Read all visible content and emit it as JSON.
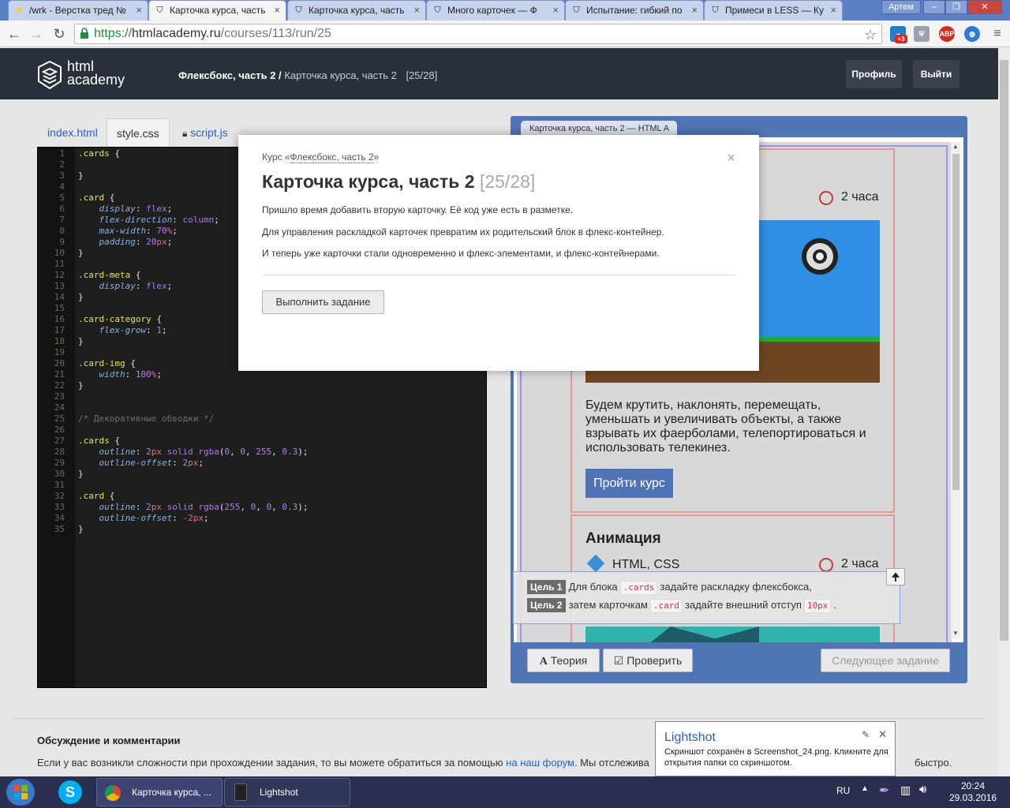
{
  "browser": {
    "tabs": [
      {
        "label": "/wrk - Верстка тред №",
        "icon": "lightning-icon"
      },
      {
        "label": "Карточка курса, часть",
        "icon": "htmlacademy-icon",
        "active": true
      },
      {
        "label": "Карточка курса, часть",
        "icon": "htmlacademy-icon"
      },
      {
        "label": "Много карточек — Ф",
        "icon": "htmlacademy-icon"
      },
      {
        "label": "Испытание: гибкий по",
        "icon": "htmlacademy-icon"
      },
      {
        "label": "Примеси в LESS — Ку",
        "icon": "htmlacademy-icon"
      }
    ],
    "user_label": "Артем",
    "url_proto": "https://",
    "url_host": "htmlacademy.ru",
    "url_path": "/courses/113/run/25",
    "ext_badge": "+3",
    "abp_label": "ABP"
  },
  "site": {
    "logo_line1": "html",
    "logo_line2": "academy",
    "crumb_parent": "Флексбокс, часть 2 /",
    "crumb_current": "Карточка курса, часть 2",
    "crumb_progress": "[25/28]",
    "profile_label": "Профиль",
    "logout_label": "Выйти"
  },
  "files": {
    "tabs": [
      "index.html",
      "style.css",
      "script.js"
    ]
  },
  "preview": {
    "tab_label": "Карточка курса, часть 2 — HTML A",
    "card1_time": "2 часа",
    "card1_text": "Будем крутить, наклонять, перемещать, уменьшать и увеличивать объекты, а также взрывать их фаерболами, телепортироваться и использовать телекинез.",
    "card1_button": "Пройти курс",
    "card2_title": "Анимация",
    "card2_category": "HTML, CSS",
    "card2_time": "2 часа",
    "colors": {
      "accent": "#5075b6",
      "button": "#5073b6",
      "sky": "#2f8fe4",
      "grass": "#17b52b",
      "dirt": "#6e4624",
      "teal": "#2fb3ab"
    }
  },
  "goals": [
    {
      "badge": "Цель 1",
      "pre": "Для блока",
      "code": ".cards",
      "post": "задайте раскладку флексбокса,"
    },
    {
      "badge": "Цель 2",
      "pre": "затем карточкам",
      "code": ".card",
      "post": "задайте внешний отступ",
      "code2": "10px",
      "tail": "."
    }
  ],
  "actions": {
    "theory": "Теория",
    "check": "Проверить",
    "next": "Следующее задание"
  },
  "modal": {
    "course_prefix": "Курс «",
    "course_link": "Флексбокс, часть 2",
    "course_suffix": "»",
    "title": "Карточка курса, часть 2",
    "progress": "[25/28]",
    "paragraphs": [
      "Пришло время добавить вторую карточку. Её код уже есть в разметке.",
      "Для управления раскладкой карточек превратим их родительский блок в флекс-контейнер.",
      "И теперь уже карточки стали одновременно и флекс-элементами, и флекс-контейнерами."
    ],
    "start_button": "Выполнить задание",
    "close_label": "×"
  },
  "comments": {
    "heading": "Обсуждение и комментарии",
    "text_before": "Если у вас возникли сложности при прохождении задания, то вы можете обратиться за помощью",
    "link": "на наш форум",
    "text_after": ". Мы отслежива",
    "text_tail": "быстро."
  },
  "notification": {
    "title": "Lightshot",
    "body": "Скриншот сохранён в Screenshot_24.png. Кликните для открытия папки со скриншотом."
  },
  "taskbar": {
    "apps": [
      "Карточка курса, ...",
      "Lightshot"
    ],
    "lang": "RU",
    "time": "20:24",
    "date": "29.03.2016"
  },
  "code_lines": [
    [
      [
        "sel",
        ".cards"
      ],
      [
        "txt",
        " {"
      ]
    ],
    [],
    [
      [
        "txt",
        "}"
      ]
    ],
    [],
    [
      [
        "sel",
        ".card"
      ],
      [
        "txt",
        " {"
      ]
    ],
    [
      [
        "txt",
        "    "
      ],
      [
        "prop",
        "display"
      ],
      [
        "txt",
        ": "
      ],
      [
        "val",
        "flex"
      ],
      [
        "txt",
        ";"
      ]
    ],
    [
      [
        "txt",
        "    "
      ],
      [
        "prop",
        "flex-direction"
      ],
      [
        "txt",
        ": "
      ],
      [
        "val",
        "column"
      ],
      [
        "txt",
        ";"
      ]
    ],
    [
      [
        "txt",
        "    "
      ],
      [
        "prop",
        "max-width"
      ],
      [
        "txt",
        ": "
      ],
      [
        "num",
        "70"
      ],
      [
        "unit",
        "%"
      ],
      [
        "txt",
        ";"
      ]
    ],
    [
      [
        "txt",
        "    "
      ],
      [
        "prop",
        "padding"
      ],
      [
        "txt",
        ": "
      ],
      [
        "num",
        "20"
      ],
      [
        "unit",
        "px"
      ],
      [
        "txt",
        ";"
      ]
    ],
    [
      [
        "txt",
        "}"
      ]
    ],
    [],
    [
      [
        "sel",
        ".card-meta"
      ],
      [
        "txt",
        " {"
      ]
    ],
    [
      [
        "txt",
        "    "
      ],
      [
        "prop",
        "display"
      ],
      [
        "txt",
        ": "
      ],
      [
        "val",
        "flex"
      ],
      [
        "txt",
        ";"
      ]
    ],
    [
      [
        "txt",
        "}"
      ]
    ],
    [],
    [
      [
        "sel",
        ".card-category"
      ],
      [
        "txt",
        " {"
      ]
    ],
    [
      [
        "txt",
        "    "
      ],
      [
        "prop",
        "flex-grow"
      ],
      [
        "txt",
        ": "
      ],
      [
        "num",
        "1"
      ],
      [
        "txt",
        ";"
      ]
    ],
    [
      [
        "txt",
        "}"
      ]
    ],
    [],
    [
      [
        "sel",
        ".card-img"
      ],
      [
        "txt",
        " {"
      ]
    ],
    [
      [
        "txt",
        "    "
      ],
      [
        "prop",
        "width"
      ],
      [
        "txt",
        ": "
      ],
      [
        "num",
        "100"
      ],
      [
        "unit",
        "%"
      ],
      [
        "txt",
        ";"
      ]
    ],
    [
      [
        "txt",
        "}"
      ]
    ],
    [],
    [],
    [
      [
        "cm",
        "/* Декоративные обводки */"
      ]
    ],
    [],
    [
      [
        "sel",
        ".cards"
      ],
      [
        "txt",
        " {"
      ]
    ],
    [
      [
        "txt",
        "    "
      ],
      [
        "prop",
        "outline"
      ],
      [
        "txt",
        ": "
      ],
      [
        "num",
        "2"
      ],
      [
        "unit",
        "px"
      ],
      [
        "txt",
        " "
      ],
      [
        "val",
        "solid"
      ],
      [
        "txt",
        " "
      ],
      [
        "val",
        "rgba"
      ],
      [
        "txt",
        "("
      ],
      [
        "num",
        "0"
      ],
      [
        "txt",
        ", "
      ],
      [
        "num",
        "0"
      ],
      [
        "txt",
        ", "
      ],
      [
        "num",
        "255"
      ],
      [
        "txt",
        ", "
      ],
      [
        "num",
        "0.3"
      ],
      [
        "txt",
        ");"
      ]
    ],
    [
      [
        "txt",
        "    "
      ],
      [
        "prop",
        "outline-offset"
      ],
      [
        "txt",
        ": "
      ],
      [
        "num",
        "2"
      ],
      [
        "unit",
        "px"
      ],
      [
        "txt",
        ";"
      ]
    ],
    [
      [
        "txt",
        "}"
      ]
    ],
    [],
    [
      [
        "sel",
        ".card"
      ],
      [
        "txt",
        " {"
      ]
    ],
    [
      [
        "txt",
        "    "
      ],
      [
        "prop",
        "outline"
      ],
      [
        "txt",
        ": "
      ],
      [
        "num",
        "2"
      ],
      [
        "unit",
        "px"
      ],
      [
        "txt",
        " "
      ],
      [
        "val",
        "solid"
      ],
      [
        "txt",
        " "
      ],
      [
        "val",
        "rgba"
      ],
      [
        "txt",
        "("
      ],
      [
        "num",
        "255"
      ],
      [
        "txt",
        ", "
      ],
      [
        "num",
        "0"
      ],
      [
        "txt",
        ", "
      ],
      [
        "num",
        "0"
      ],
      [
        "txt",
        ", "
      ],
      [
        "num",
        "0.3"
      ],
      [
        "txt",
        ");"
      ]
    ],
    [
      [
        "txt",
        "    "
      ],
      [
        "prop",
        "outline-offset"
      ],
      [
        "txt",
        ": "
      ],
      [
        "unit",
        "-2px"
      ],
      [
        "txt",
        ";"
      ]
    ],
    [
      [
        "txt",
        "}"
      ]
    ]
  ]
}
